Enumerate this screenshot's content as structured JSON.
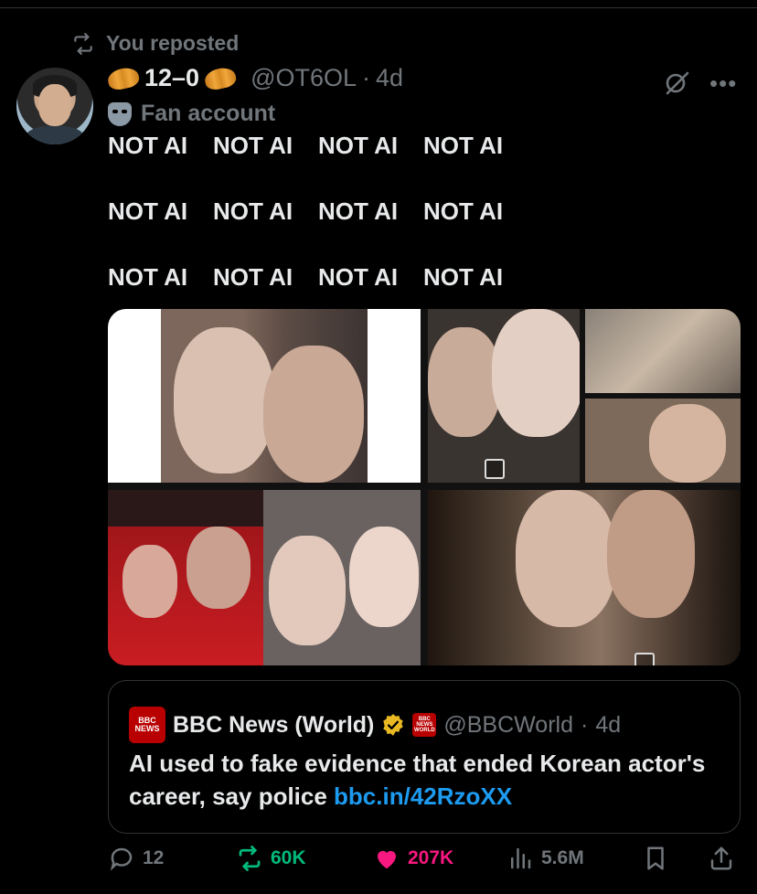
{
  "repost_header": {
    "label": "You reposted"
  },
  "author": {
    "display_name": "12–0",
    "handle": "@OT6OL",
    "separator": "·",
    "age": "4d",
    "label": "Fan account"
  },
  "tweet_text_lines": [
    [
      "NOT AI",
      "NOT AI",
      "NOT AI",
      "NOT AI"
    ],
    [
      "NOT AI",
      "NOT AI",
      "NOT AI",
      "NOT AI"
    ],
    [
      "NOT AI",
      "NOT AI",
      "NOT AI",
      "NOT AI"
    ]
  ],
  "quoted": {
    "logo_top": "BBC",
    "logo_bottom": "NEWS",
    "logo_small_bottom": "WORLD",
    "name": "BBC News (World)",
    "handle": "@BBCWorld",
    "separator": "·",
    "age": "4d",
    "text": "AI used to fake evidence that ended Korean actor's career, say police ",
    "link": "bbc.in/42RzoXX"
  },
  "actions": {
    "replies": "12",
    "reposts": "60K",
    "likes": "207K",
    "views": "5.6M"
  },
  "colors": {
    "background": "#000000",
    "muted": "#71767b",
    "repost_active": "#00ba7c",
    "like_active": "#f91880",
    "link": "#1d9bf0",
    "bbc_red": "#b80000"
  }
}
